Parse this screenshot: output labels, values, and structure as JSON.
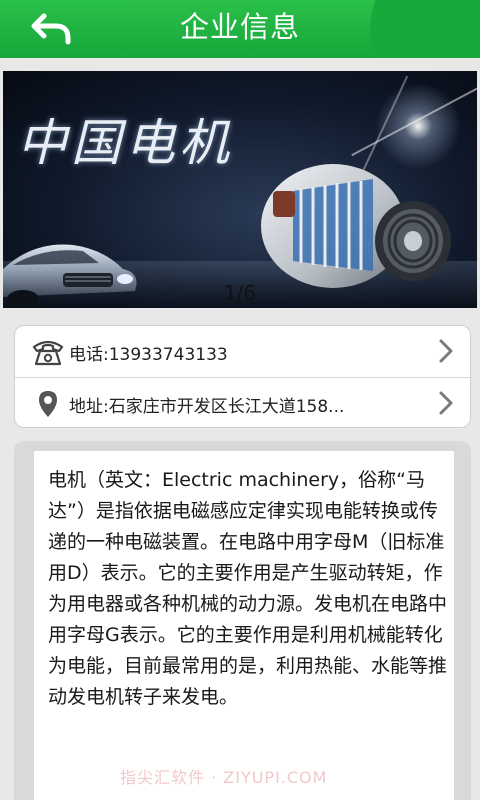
{
  "header": {
    "title": "企业信息",
    "back_icon": "back-arrow-icon",
    "color": "#1aa83c"
  },
  "banner": {
    "caption": "中国电机",
    "pager": "1/6"
  },
  "contact": {
    "phone": "电话:13933743133",
    "address": "地址:石家庄市开发区长江大道158...",
    "phone_icon": "telephone-icon",
    "address_icon": "location-pin-icon"
  },
  "description": {
    "text": "电机（英文：Electric machinery，俗称“马达”）是指依据电磁感应定律实现电能转换或传递的一种电磁装置。在电路中用字母M（旧标准用D）表示。它的主要作用是产生驱动转矩，作为用电器或各种机械的动力源。发电机在电路中用字母G表示。它的主要作用是利用机械能转化为电能，目前最常用的是，利用热能、水能等推动发电机转子来发电。"
  },
  "watermark": "指尖汇软件 · ZIYUPI.COM"
}
